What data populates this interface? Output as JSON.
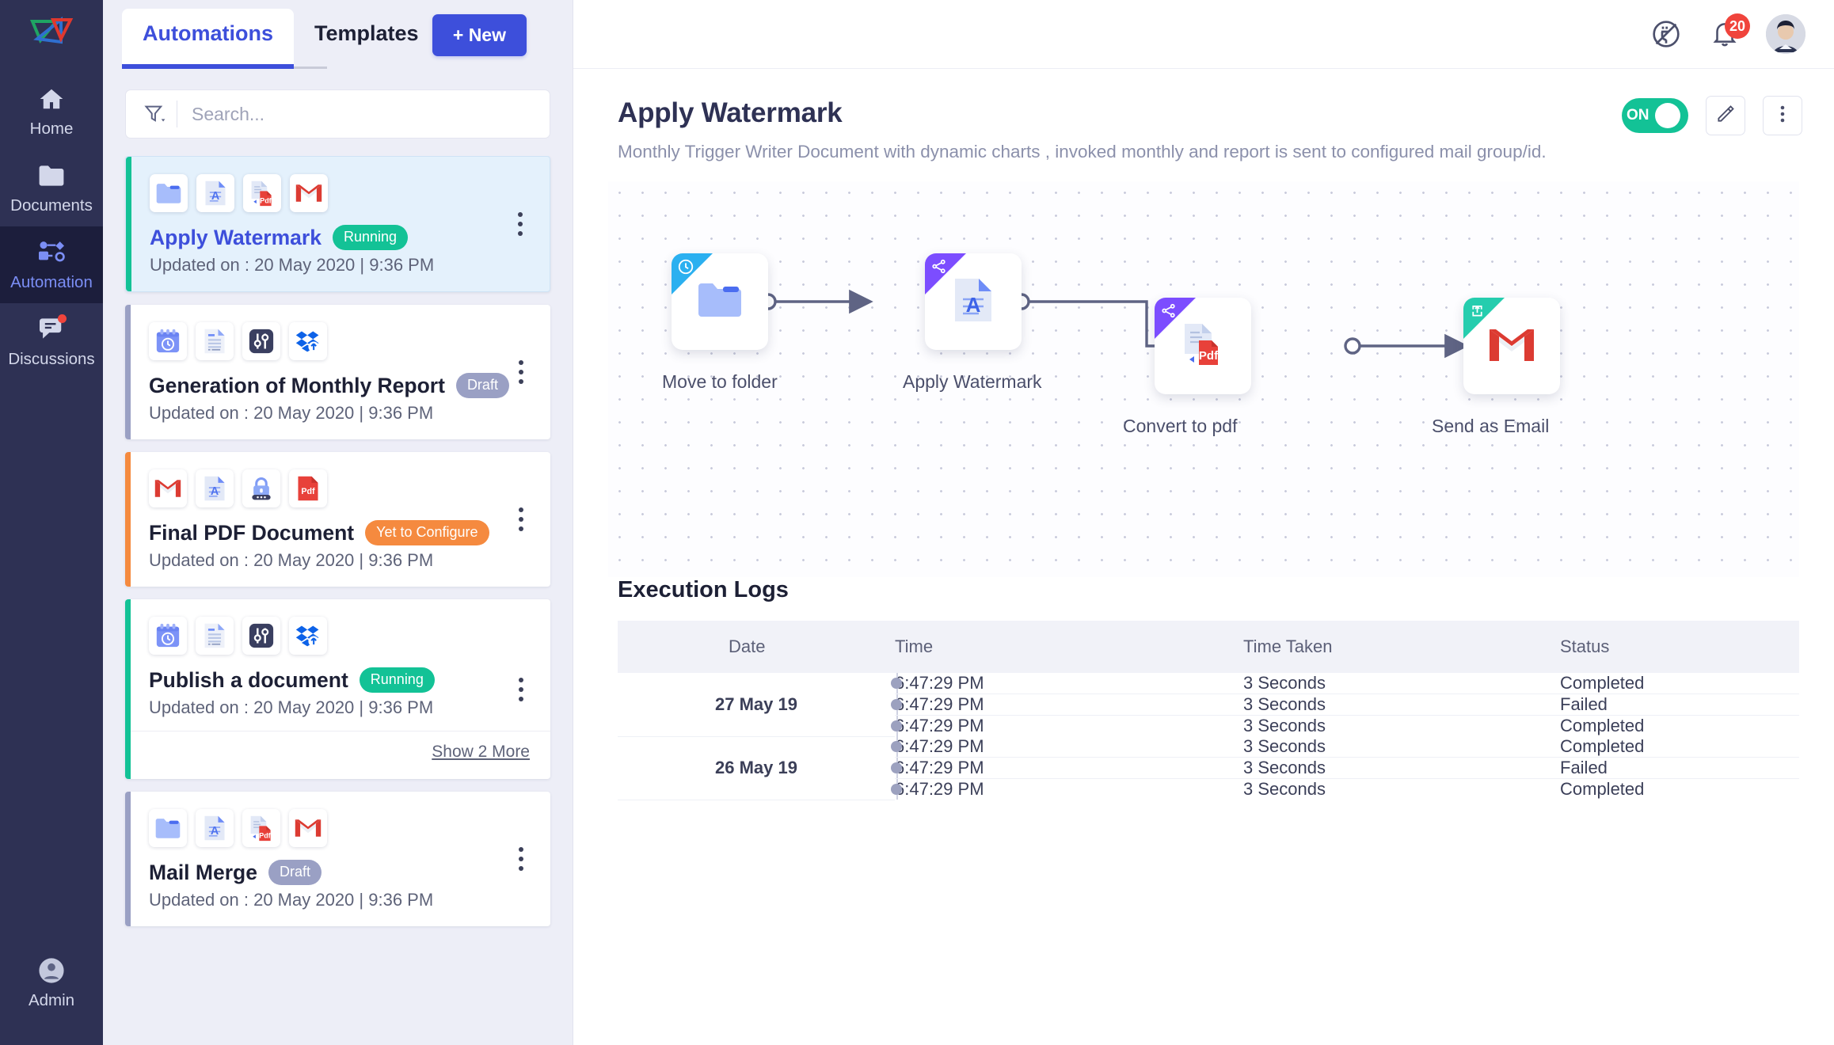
{
  "rail": {
    "logo_name": "app-logo",
    "items": [
      {
        "label": "Home",
        "icon": "home-icon",
        "active": false,
        "dot": false
      },
      {
        "label": "Documents",
        "icon": "folder-icon",
        "active": false,
        "dot": false
      },
      {
        "label": "Automation",
        "icon": "automation-flow-icon",
        "active": true,
        "dot": false
      },
      {
        "label": "Discussions",
        "icon": "chat-bubble-icon",
        "active": false,
        "dot": true
      }
    ],
    "bottom": {
      "label": "Admin",
      "icon": "user-avatar-icon"
    }
  },
  "list_panel": {
    "tabs": [
      {
        "label": "Automations",
        "active": true
      },
      {
        "label": "Templates",
        "active": false
      }
    ],
    "new_button": "+ New",
    "search": {
      "placeholder": "Search...",
      "value": ""
    },
    "show_more": "Show 2 More",
    "cards": [
      {
        "title": "Apply Watermark",
        "badge": "Running",
        "badge_kind": "running",
        "updated": "Updated on : 20 May 2020 | 9:36 PM",
        "selected": true,
        "icons": [
          "folder-icon",
          "watermark-doc-icon",
          "doc-to-pdf-icon",
          "gmail-icon"
        ]
      },
      {
        "title": "Generation of Monthly Report",
        "badge": "Draft",
        "badge_kind": "draft",
        "updated": "Updated on : 20 May 2020 | 9:36 PM",
        "selected": false,
        "icons": [
          "calendar-clock-icon",
          "document-icon",
          "sliders-icon",
          "dropbox-upload-icon"
        ]
      },
      {
        "title": "Final PDF Document",
        "badge": "Yet to Configure",
        "badge_kind": "config",
        "updated": "Updated on : 20 May 2020 | 9:36 PM",
        "selected": false,
        "icons": [
          "gmail-icon",
          "watermark-doc-icon",
          "lock-icon",
          "pdf-icon"
        ]
      },
      {
        "title": "Publish a document",
        "badge": "Running",
        "badge_kind": "running",
        "updated": "Updated on : 20 May 2020 | 9:36 PM",
        "selected": false,
        "icons": [
          "calendar-clock-icon",
          "document-icon",
          "sliders-icon",
          "dropbox-upload-icon"
        ]
      },
      {
        "title": "Mail Merge",
        "badge": "Draft",
        "badge_kind": "draft",
        "updated": "Updated on : 20 May 2020 | 9:36 PM",
        "selected": false,
        "icons": [
          "folder-icon",
          "watermark-doc-icon",
          "doc-to-pdf-icon",
          "gmail-icon"
        ]
      }
    ]
  },
  "topbar": {
    "plugin_icon": "plugin-disabled-icon",
    "bell_icon": "bell-icon",
    "notification_count": "20",
    "avatar": "user-avatar"
  },
  "detail": {
    "title": "Apply Watermark",
    "subtitle": "Monthly Trigger Writer Document with dynamic charts , invoked monthly and report is sent to configured mail group/id.",
    "toggle_label": "ON",
    "toggle_on": true,
    "edit_icon": "pencil-icon",
    "more_icon": "kebab-menu-icon"
  },
  "flow": {
    "nodes": [
      {
        "label": "Move to folder",
        "corner": "blue",
        "corner_icon": "clock-icon",
        "icon": "folder-icon"
      },
      {
        "label": "Apply Watermark",
        "corner": "purple",
        "corner_icon": "share-icon",
        "icon": "watermark-doc-icon"
      },
      {
        "label": "Convert to pdf",
        "corner": "purple",
        "corner_icon": "share-icon",
        "icon": "doc-to-pdf-icon"
      },
      {
        "label": "Send as Email",
        "corner": "teal",
        "corner_icon": "send-icon",
        "icon": "gmail-icon"
      }
    ]
  },
  "logs": {
    "title": "Execution Logs",
    "columns": [
      "Date",
      "Time",
      "Time Taken",
      "Status"
    ],
    "groups": [
      {
        "date": "27 May 19",
        "rows": [
          {
            "time": "6:47:29 PM",
            "taken": "3 Seconds",
            "status": "Completed"
          },
          {
            "time": "6:47:29 PM",
            "taken": "3 Seconds",
            "status": "Failed"
          },
          {
            "time": "6:47:29 PM",
            "taken": "3 Seconds",
            "status": "Completed"
          }
        ]
      },
      {
        "date": "26 May 19",
        "rows": [
          {
            "time": "6:47:29 PM",
            "taken": "3 Seconds",
            "status": "Completed"
          },
          {
            "time": "6:47:29 PM",
            "taken": "3 Seconds",
            "status": "Failed"
          },
          {
            "time": "6:47:29 PM",
            "taken": "3 Seconds",
            "status": "Completed"
          }
        ]
      }
    ]
  },
  "colors": {
    "accent": "#3d4fdb",
    "rail_bg": "#2e3154",
    "running": "#13c296",
    "draft": "#9aa0c4",
    "config": "#f58a3f",
    "completed": "#18a94a",
    "failed": "#e8443c"
  }
}
